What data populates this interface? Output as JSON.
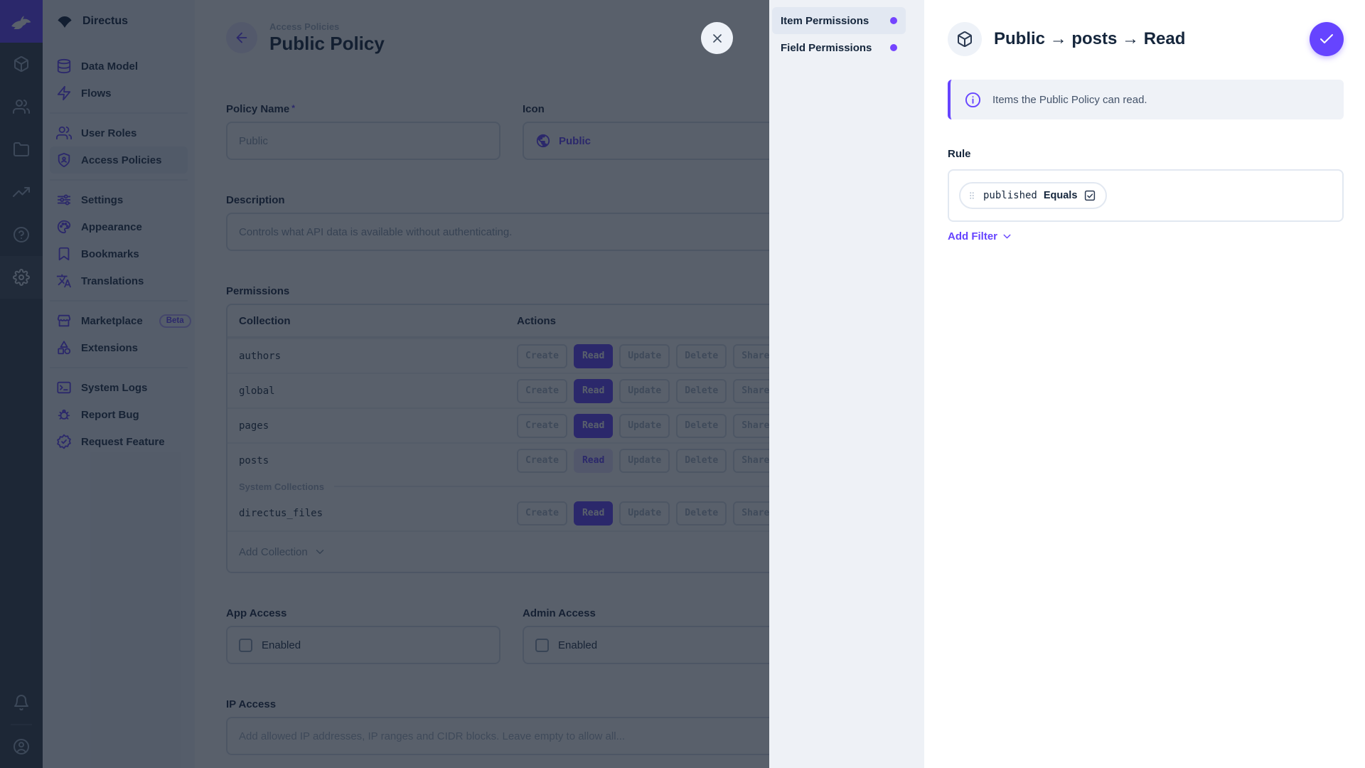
{
  "accent": "#6644ff",
  "module_bar": {
    "logo_icon": "rabbit-logo-icon",
    "modules": [
      {
        "name": "content",
        "icon": "box-icon",
        "active": false
      },
      {
        "name": "users",
        "icon": "users-icon",
        "active": false
      },
      {
        "name": "files",
        "icon": "folder-icon",
        "active": false
      },
      {
        "name": "insights",
        "icon": "insights-icon",
        "active": false
      },
      {
        "name": "docs",
        "icon": "help-icon",
        "active": false
      },
      {
        "name": "settings",
        "icon": "gear-icon",
        "active": true
      }
    ],
    "bottom": [
      {
        "name": "notifications",
        "icon": "bell-icon"
      },
      {
        "name": "account",
        "icon": "user-circle-icon"
      }
    ]
  },
  "nav": {
    "project_name": "Directus",
    "project_icon": "project-icon",
    "groups": [
      {
        "items": [
          {
            "label": "Data Model",
            "icon": "database-icon",
            "active": false
          },
          {
            "label": "Flows",
            "icon": "bolt-icon",
            "active": false
          }
        ]
      },
      {
        "items": [
          {
            "label": "User Roles",
            "icon": "user-roles-icon",
            "active": false
          },
          {
            "label": "Access Policies",
            "icon": "access-policies-icon",
            "active": true
          }
        ]
      },
      {
        "items": [
          {
            "label": "Settings",
            "icon": "sliders-icon",
            "active": false
          },
          {
            "label": "Appearance",
            "icon": "palette-icon",
            "active": false
          },
          {
            "label": "Bookmarks",
            "icon": "bookmark-icon",
            "active": false
          },
          {
            "label": "Translations",
            "icon": "translate-icon",
            "active": false
          }
        ]
      },
      {
        "items": [
          {
            "label": "Marketplace",
            "icon": "storefront-icon",
            "badge": "Beta",
            "active": false
          },
          {
            "label": "Extensions",
            "icon": "category-icon",
            "active": false
          }
        ]
      },
      {
        "items": [
          {
            "label": "System Logs",
            "icon": "terminal-icon",
            "active": false
          },
          {
            "label": "Report Bug",
            "icon": "bug-icon",
            "active": false
          },
          {
            "label": "Request Feature",
            "icon": "feature-icon",
            "active": false
          }
        ]
      }
    ]
  },
  "main": {
    "breadcrumb": "Access Policies",
    "title": "Public Policy",
    "fields": {
      "policy_name": {
        "label": "Policy Name",
        "required_marker": "*",
        "value": "Public"
      },
      "icon": {
        "label": "Icon",
        "value": "Public",
        "icon": "globe-icon"
      },
      "description": {
        "label": "Description",
        "value": "Controls what API data is available without authenticating."
      },
      "app_access": {
        "label": "App Access",
        "checkbox_label": "Enabled",
        "checked": false
      },
      "admin_access": {
        "label": "Admin Access",
        "checkbox_label": "Enabled",
        "checked": false
      },
      "ip_access": {
        "label": "IP Access",
        "placeholder": "Add allowed IP addresses, IP ranges and CIDR blocks. Leave empty to allow all..."
      }
    },
    "permissions": {
      "label": "Permissions",
      "columns": [
        "Collection",
        "Actions"
      ],
      "actions": [
        "Create",
        "Read",
        "Update",
        "Delete",
        "Share"
      ],
      "rows": [
        {
          "collection": "authors",
          "granted": [
            "Read"
          ]
        },
        {
          "collection": "global",
          "granted": [
            "Read"
          ]
        },
        {
          "collection": "pages",
          "granted": [
            "Read"
          ]
        },
        {
          "collection": "posts",
          "granted": [
            "Read"
          ],
          "editing": "Read"
        },
        {
          "collection": "directus_files",
          "granted": [
            "Read"
          ],
          "group": "System Collections"
        }
      ],
      "add_collection_label": "Add Collection"
    }
  },
  "drawer": {
    "tabs": [
      {
        "label": "Item Permissions",
        "active": true,
        "dot": true
      },
      {
        "label": "Field Permissions",
        "active": false,
        "dot": true
      }
    ],
    "header": {
      "icon": "box-icon",
      "title": "Public → posts → Read"
    },
    "banner": {
      "icon": "info-icon",
      "text": "Items the Public Policy can read."
    },
    "rule": {
      "label": "Rule",
      "field": "published",
      "operator": "Equals",
      "value_checked": true
    },
    "add_filter_label": "Add Filter"
  }
}
